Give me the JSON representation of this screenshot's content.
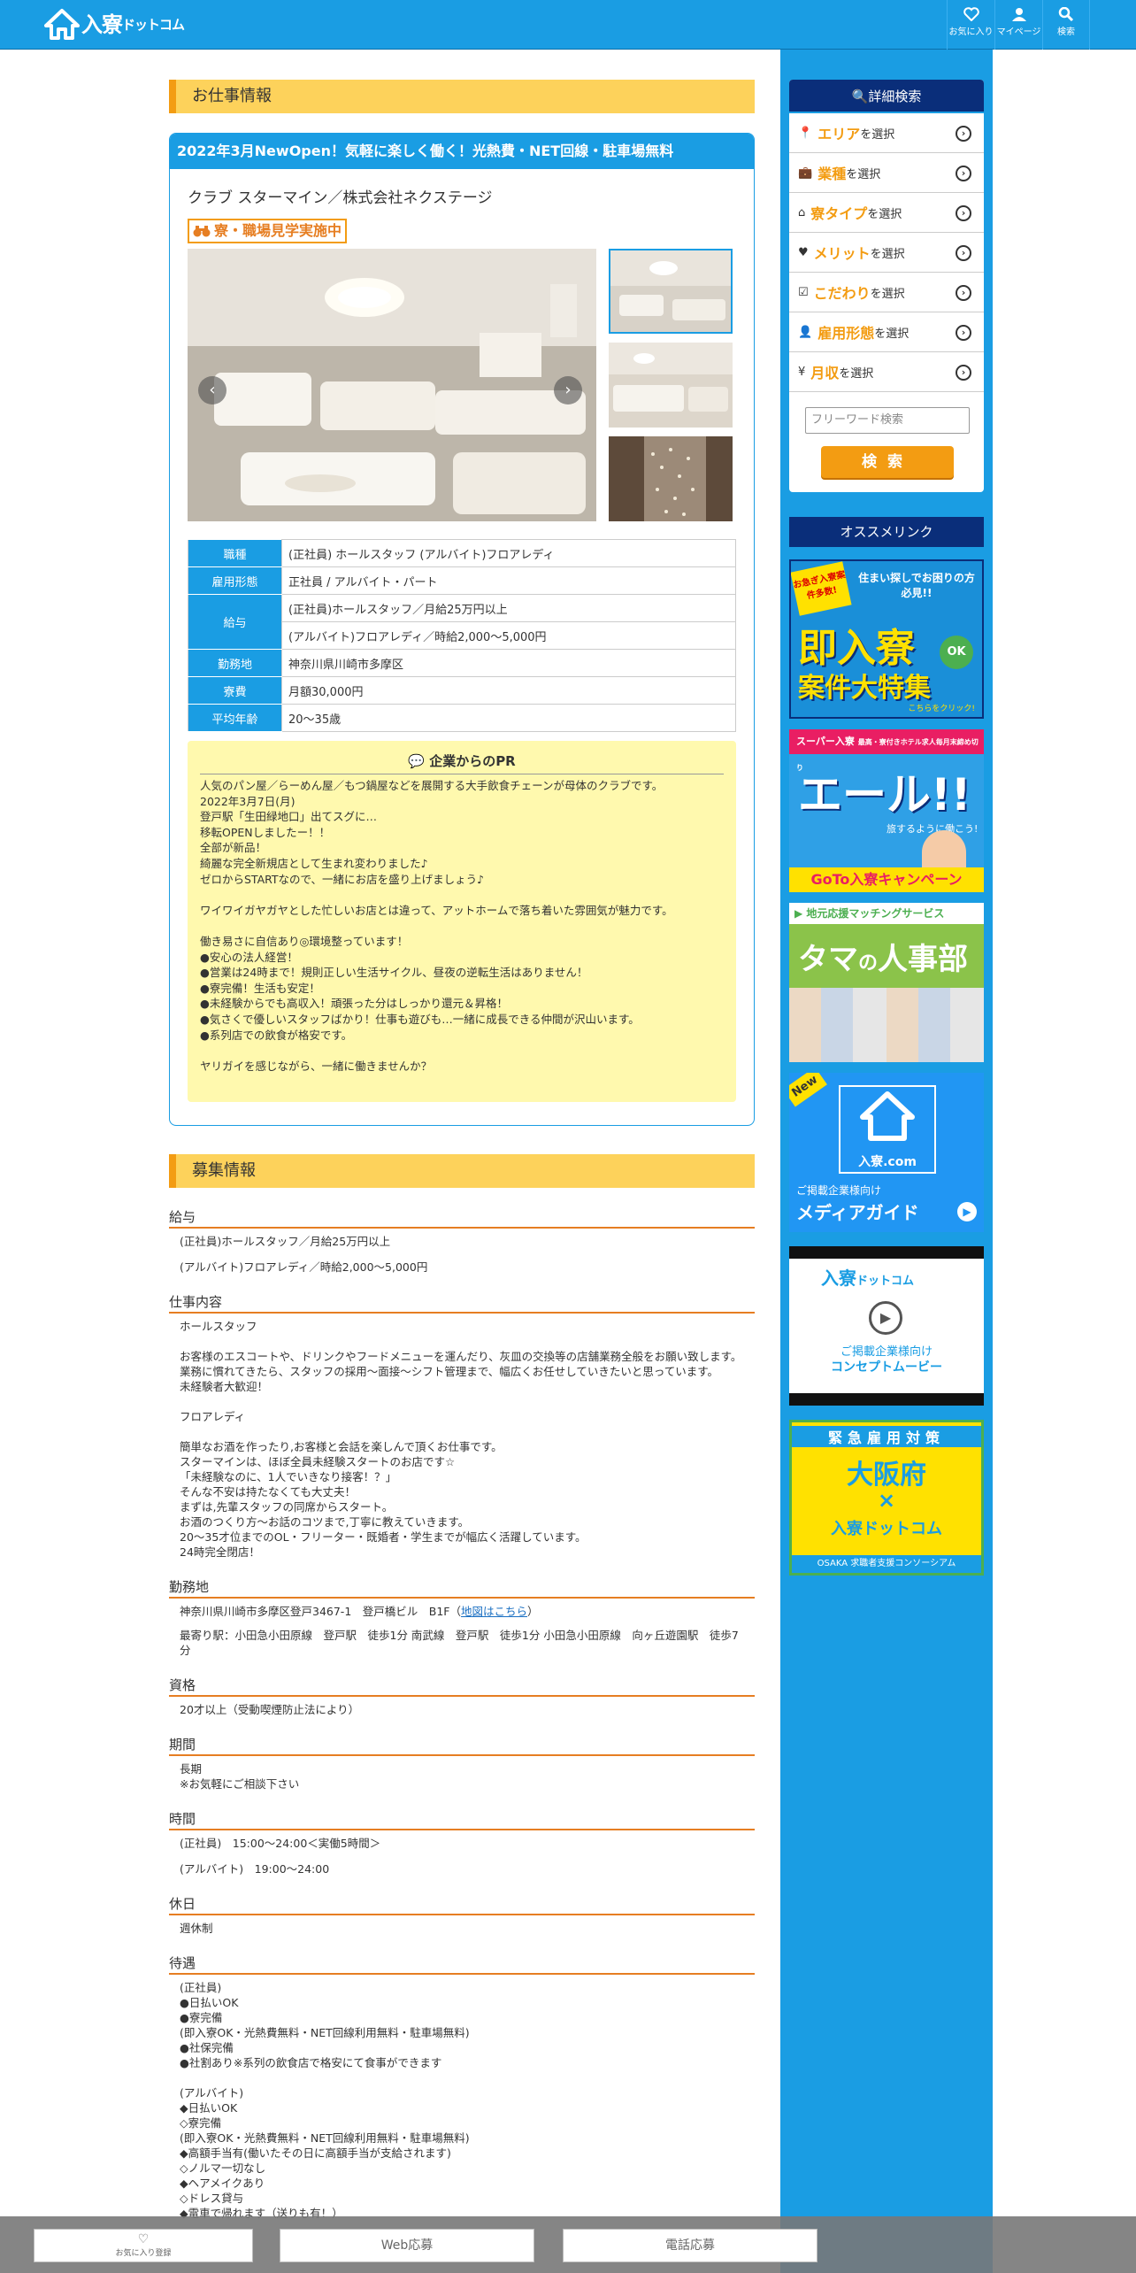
{
  "header": {
    "logo_main": "入寮",
    "logo_sub": "ドットコム",
    "nav": [
      {
        "label": "お気に入り",
        "icon": "heart-icon"
      },
      {
        "label": "マイページ",
        "icon": "user-icon"
      },
      {
        "label": "検索",
        "icon": "search-icon"
      }
    ]
  },
  "colors": {
    "brand": "#1a9de3",
    "accent": "#f39c12",
    "navy": "#0a2e7a",
    "pr_bg": "#fff9ae"
  },
  "job": {
    "section_title": "お仕事情報",
    "title": "2022年3月NewOpen！気軽に楽しく働く！光熱費・NET回線・駐車場無料",
    "company": "クラブ スターマイン／株式会社ネクステージ",
    "tour_badge": "寮・職場見学実施中",
    "table": [
      {
        "k": "職種",
        "v": [
          "(正社員) ホールスタッフ (アルバイト)フロアレディ"
        ]
      },
      {
        "k": "雇用形態",
        "v": [
          "正社員 / アルバイト・パート"
        ]
      },
      {
        "k": "給与",
        "v": [
          "(正社員)ホールスタッフ／月給25万円以上",
          "(アルバイト)フロアレディ／時給2,000～5,000円"
        ]
      },
      {
        "k": "勤務地",
        "v": [
          "神奈川県川崎市多摩区"
        ]
      },
      {
        "k": "寮費",
        "v": [
          "月額30,000円"
        ]
      },
      {
        "k": "平均年齢",
        "v": [
          "20～35歳"
        ]
      }
    ],
    "pr_title": "企業からのPR",
    "pr_body": "人気のパン屋／らーめん屋／もつ鍋屋などを展開する大手飲食チェーンが母体のクラブです。\n2022年3月7日(月)\n登戸駅「生田緑地口」出てスグに…\n移転OPENしましたー！！\n全部が新品！\n綺麗な完全新規店として生まれ変わりました♪\nゼロからSTARTなので、一緒にお店を盛り上げましょう♪\n\nワイワイガヤガヤとした忙しいお店とは違って、アットホームで落ち着いた雰囲気が魅力です。\n\n働き易さに自信あり◎環境整っています！\n●安心の法人経営！\n●営業は24時まで！規則正しい生活サイクル、昼夜の逆転生活はありません！\n●寮完備！生活も安定！\n●未経験からでも高収入！頑張った分はしっかり還元＆昇格！\n●気さくで優しいスタッフばかり！仕事も遊びも…一緒に成長できる仲間が沢山います。\n●系列店での飲食が格安です。\n\nヤリガイを感じながら、一緒に働きませんか？"
  },
  "recruit": {
    "section_title": "募集情報",
    "salary_h": "給与",
    "salary": [
      "(正社員)ホールスタッフ／月給25万円以上",
      "(アルバイト)フロアレディ／時給2,000～5,000円"
    ],
    "work_h": "仕事内容",
    "work": "ホールスタッフ\n\nお客様のエスコートや、ドリンクやフードメニューを運んだり、灰皿の交換等の店舗業務全般をお願い致します。\n業務に慣れてきたら、スタッフの採用～面接～シフト管理まで、幅広くお任せしていきたいと思っています。\n未経験者大歓迎！\n\nフロアレディ\n\n簡単なお酒を作ったり,お客様と会話を楽しんで頂くお仕事です。\nスターマインは、ほぼ全員未経験スタートのお店です☆\n「未経験なのに、1人でいきなり接客！？」\nそんな不安は持たなくても大丈夫！\nまずは,先輩スタッフの同席からスタート。\nお酒のつくり方～お話のコツまで,丁寧に教えていきます。\n20～35才位までのOL・フリーター・既婚者・学生までが幅広く活躍しています。\n24時完全閉店！",
    "place_h": "勤務地",
    "place": "神奈川県川崎市多摩区登戸3467-1　登戸橋ビル　B1F",
    "map_link": "地図はこちら",
    "station": "最寄り駅：小田急小田原線　登戸駅　徒歩1分 南武線　登戸駅　徒歩1分 小田急小田原線　向ヶ丘遊園駅　徒歩7分",
    "qual_h": "資格",
    "qual": "20才以上（受動喫煙防止法により）",
    "period_h": "期間",
    "period": "長期\n※お気軽にご相談下さい",
    "time_h": "時間",
    "time": [
      "(正社員)　15:00～24:00＜実働5時間＞",
      "(アルバイト)　19:00～24:00"
    ],
    "holiday_h": "休日",
    "holiday": "週休制",
    "treat_h": "待遇",
    "treat1": "(正社員)\n●日払いOK\n●寮完備\n(即入寮OK・光熱費無料・NET回線利用無料・駐車場無料)\n●社保完備\n●社割あり※系列の飲食店で格安にて食事ができます",
    "treat2": "(アルバイト)\n◆日払いOK\n◇寮完備\n(即入寮OK・光熱費無料・NET回線利用無料・駐車場無料)\n◆高額手当有(働いたその日に高額手当が支給されます)\n◇ノルマ一切なし\n◆ヘアメイクあり\n◇ドレス貸与\n◆電車で帰れます（送りも有！）"
  },
  "sidebar": {
    "search_title": "詳細検索",
    "items": [
      {
        "hl": "エリア",
        "rest": "を選択",
        "icon": "map-pin-icon"
      },
      {
        "hl": "業種",
        "rest": "を選択",
        "icon": "briefcase-icon"
      },
      {
        "hl": "寮タイプ",
        "rest": "を選択",
        "icon": "home-icon"
      },
      {
        "hl": "メリット",
        "rest": "を選択",
        "icon": "heart-icon"
      },
      {
        "hl": "こだわり",
        "rest": "を選択",
        "icon": "clipboard-check-icon"
      },
      {
        "hl": "雇用形態",
        "rest": "を選択",
        "icon": "user-tie-icon"
      },
      {
        "hl": "月収",
        "rest": "を選択",
        "icon": "yen-coin-icon"
      }
    ],
    "freeword_placeholder": "フリーワード検索",
    "search_button": "検索",
    "recommend_title": "オススメリンク",
    "banners": {
      "b1": {
        "line1": "お急ぎ入寮案件多数!",
        "line2": "住まい探しでお困りの方必見!!",
        "big": "即入寮",
        "ok": "OK",
        "big2": "案件大特集",
        "small": "こちらをクリック!"
      },
      "b2": {
        "brand": "スーパー入寮",
        "line": "最高・寮付きホテル求人毎月末締め切り",
        "big": "エール!!",
        "sub": "旅するように働こう!",
        "foot": "GoTo入寮キャンペーン"
      },
      "b3": {
        "top": "地元応援マッチングサービス",
        "big": "タマ",
        "mid": "の",
        "big2": "人事部"
      },
      "b4": {
        "new": "New",
        "brand": "入寮.com",
        "line": "ご掲載企業様向け",
        "big": "メディアガイド"
      },
      "b5": {
        "brand": "入寮",
        "sub": "ドットコム",
        "line1": "ご掲載企業様向け",
        "line2": "コンセプトムービー"
      },
      "b6": {
        "top": "緊急雇用対策",
        "big": "大阪府",
        "x": "×",
        "brand": "入寮ドットコム",
        "foot": "OSAKA 求職者支援コンソーシアム"
      }
    }
  },
  "bottom_bar": {
    "fav": "お気に入り登録",
    "web": "Web応募",
    "tel": "電話応募"
  }
}
